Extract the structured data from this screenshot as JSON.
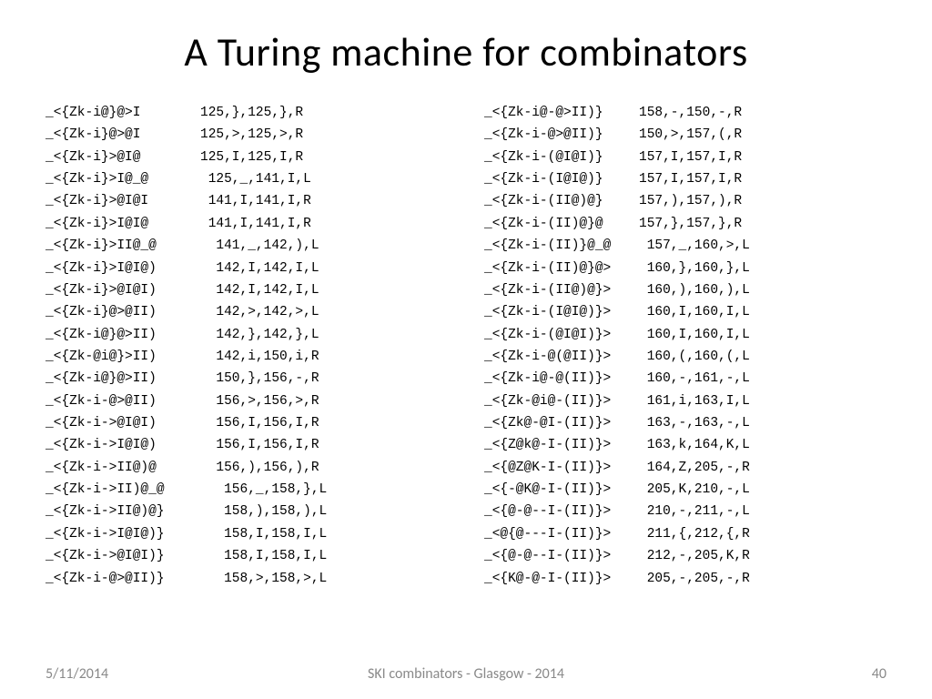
{
  "title": "A Turing machine for combinators",
  "footer": {
    "date": "5/11/2014",
    "center": "SKI combinators - Glasgow - 2014",
    "page": "40"
  },
  "left": [
    {
      "c1": "_<{Zk-i@}@>I",
      "c2": "125,},125,},R"
    },
    {
      "c1": "_<{Zk-i}@>@I",
      "c2": "125,>,125,>,R"
    },
    {
      "c1": "_<{Zk-i}>@I@",
      "c2": "125,I,125,I,R"
    },
    {
      "c1": "_<{Zk-i}>I@_@",
      "c2": " 125,_,141,I,L"
    },
    {
      "c1": "_<{Zk-i}>@I@I",
      "c2": " 141,I,141,I,R"
    },
    {
      "c1": "_<{Zk-i}>I@I@",
      "c2": " 141,I,141,I,R"
    },
    {
      "c1": "_<{Zk-i}>II@_@",
      "c2": "  141,_,142,),L"
    },
    {
      "c1": "_<{Zk-i}>I@I@)",
      "c2": "  142,I,142,I,L"
    },
    {
      "c1": "_<{Zk-i}>@I@I)",
      "c2": "  142,I,142,I,L"
    },
    {
      "c1": "_<{Zk-i}@>@II)",
      "c2": "  142,>,142,>,L"
    },
    {
      "c1": "_<{Zk-i@}@>II)",
      "c2": "  142,},142,},L"
    },
    {
      "c1": "_<{Zk-@i@}>II)",
      "c2": "  142,i,150,i,R"
    },
    {
      "c1": "_<{Zk-i@}@>II)",
      "c2": "  150,},156,-,R"
    },
    {
      "c1": "_<{Zk-i-@>@II)",
      "c2": "  156,>,156,>,R"
    },
    {
      "c1": "_<{Zk-i->@I@I)",
      "c2": "  156,I,156,I,R"
    },
    {
      "c1": "_<{Zk-i->I@I@)",
      "c2": "  156,I,156,I,R"
    },
    {
      "c1": "_<{Zk-i->II@)@",
      "c2": "  156,),156,),R"
    },
    {
      "c1": "_<{Zk-i->II)@_@",
      "c2": "   156,_,158,},L"
    },
    {
      "c1": "_<{Zk-i->II@)@}",
      "c2": "   158,),158,),L"
    },
    {
      "c1": "_<{Zk-i->I@I@)}",
      "c2": "   158,I,158,I,L"
    },
    {
      "c1": "_<{Zk-i->@I@I)}",
      "c2": "   158,I,158,I,L"
    },
    {
      "c1": "_<{Zk-i-@>@II)}",
      "c2": "   158,>,158,>,L"
    }
  ],
  "right": [
    {
      "c1": "_<{Zk-i@-@>II)}",
      "c2": "158,-,150,-,R"
    },
    {
      "c1": "_<{Zk-i-@>@II)}",
      "c2": "150,>,157,(,R"
    },
    {
      "c1": "_<{Zk-i-(@I@I)}",
      "c2": "157,I,157,I,R"
    },
    {
      "c1": "_<{Zk-i-(I@I@)}",
      "c2": "157,I,157,I,R"
    },
    {
      "c1": "_<{Zk-i-(II@)@}",
      "c2": "157,),157,),R"
    },
    {
      "c1": "_<{Zk-i-(II)@}@",
      "c2": "157,},157,},R"
    },
    {
      "c1": "_<{Zk-i-(II)}@_@",
      "c2": " 157,_,160,>,L"
    },
    {
      "c1": "_<{Zk-i-(II)@}@>",
      "c2": " 160,},160,},L"
    },
    {
      "c1": "_<{Zk-i-(II@)@}>",
      "c2": " 160,),160,),L"
    },
    {
      "c1": "_<{Zk-i-(I@I@)}>",
      "c2": " 160,I,160,I,L"
    },
    {
      "c1": "_<{Zk-i-(@I@I)}>",
      "c2": " 160,I,160,I,L"
    },
    {
      "c1": "_<{Zk-i-@(@II)}>",
      "c2": " 160,(,160,(,L"
    },
    {
      "c1": "_<{Zk-i@-@(II)}>",
      "c2": " 160,-,161,-,L"
    },
    {
      "c1": "_<{Zk-@i@-(II)}>",
      "c2": " 161,i,163,I,L"
    },
    {
      "c1": "_<{Zk@-@I-(II)}>",
      "c2": " 163,-,163,-,L"
    },
    {
      "c1": "_<{Z@k@-I-(II)}>",
      "c2": " 163,k,164,K,L"
    },
    {
      "c1": "_<{@Z@K-I-(II)}>",
      "c2": " 164,Z,205,-,R"
    },
    {
      "c1": "_<{-@K@-I-(II)}>",
      "c2": " 205,K,210,-,L"
    },
    {
      "c1": "_<{@-@--I-(II)}>",
      "c2": " 210,-,211,-,L"
    },
    {
      "c1": "_<@{@---I-(II)}>",
      "c2": " 211,{,212,{,R"
    },
    {
      "c1": "_<{@-@--I-(II)}>",
      "c2": " 212,-,205,K,R"
    },
    {
      "c1": "_<{K@-@-I-(II)}>",
      "c2": " 205,-,205,-,R"
    }
  ]
}
